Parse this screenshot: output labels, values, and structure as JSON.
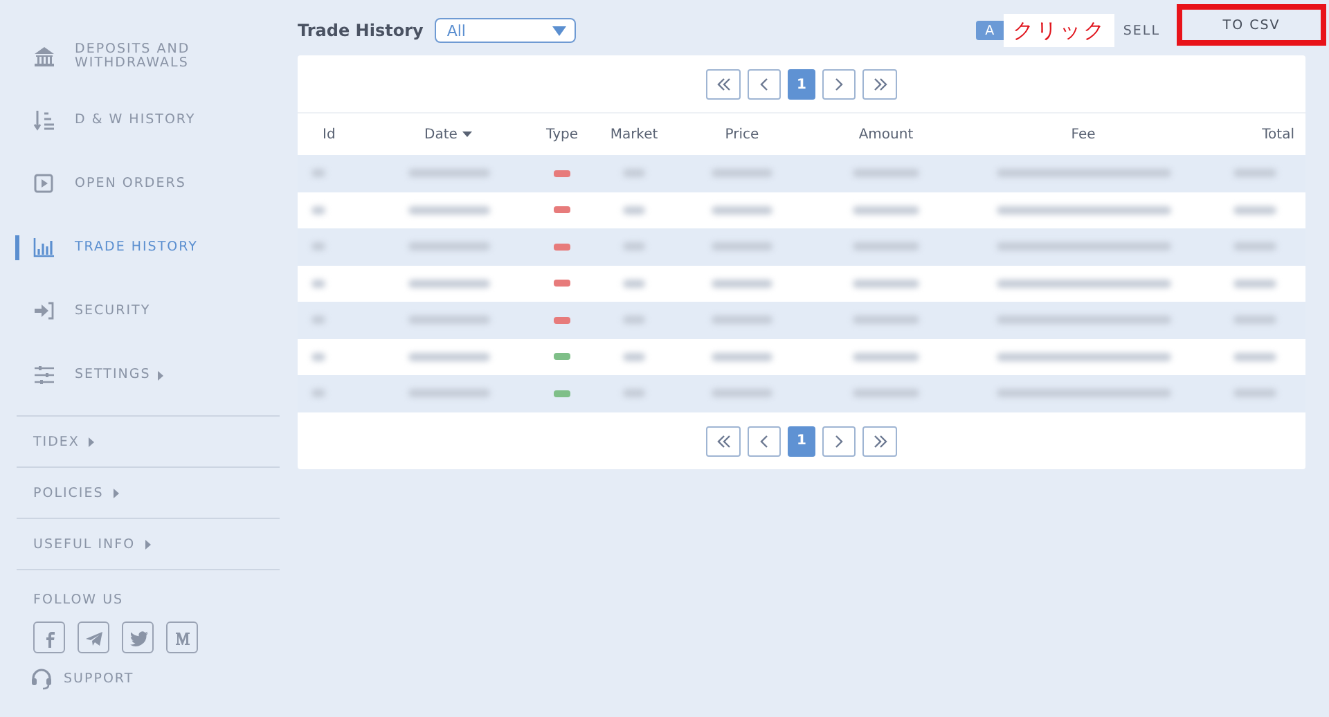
{
  "sidebar": {
    "items": [
      {
        "label": "DEPOSITS AND WITHDRAWALS",
        "selected": false,
        "submenu": false
      },
      {
        "label": "D & W HISTORY",
        "selected": false,
        "submenu": false
      },
      {
        "label": "OPEN ORDERS",
        "selected": false,
        "submenu": false
      },
      {
        "label": "TRADE HISTORY",
        "selected": true,
        "submenu": false
      },
      {
        "label": "SECURITY",
        "selected": false,
        "submenu": false
      },
      {
        "label": "SETTINGS",
        "selected": false,
        "submenu": true
      }
    ],
    "sections": [
      {
        "label": "TIDEX"
      },
      {
        "label": "POLICIES"
      },
      {
        "label": "USEFUL INFO"
      }
    ],
    "follow": {
      "title": "FOLLOW US",
      "links": [
        {
          "kind": "facebook"
        },
        {
          "kind": "telegram"
        },
        {
          "kind": "twitter"
        },
        {
          "kind": "medium"
        }
      ]
    },
    "support": "SUPPORT"
  },
  "header": {
    "title": "Trade History",
    "select": {
      "value": "All"
    },
    "filters": [
      {
        "label": "A",
        "selected": true
      },
      {
        "label": "SELL",
        "selected": false
      }
    ],
    "annotation": "クリック",
    "export": "TO CSV"
  },
  "pagers": [
    {
      "pages": [
        {
          "label": "1",
          "selected": true
        }
      ]
    },
    {
      "pages": [
        {
          "label": "1",
          "selected": true
        }
      ]
    }
  ],
  "table": {
    "columns": [
      {
        "label": "Id"
      },
      {
        "label": "Date",
        "sorted": true
      },
      {
        "label": "Type"
      },
      {
        "label": "Market"
      },
      {
        "label": "Price"
      },
      {
        "label": "Amount"
      },
      {
        "label": "Fee"
      },
      {
        "label": "Total"
      }
    ],
    "rows": [
      {
        "color": "#e77b7b"
      },
      {
        "color": "#e77b7b"
      },
      {
        "color": "#e77b7b"
      },
      {
        "color": "#e77b7b"
      },
      {
        "color": "#e77b7b"
      },
      {
        "color": "#7fbf88"
      },
      {
        "color": "#7fbf88"
      }
    ]
  }
}
